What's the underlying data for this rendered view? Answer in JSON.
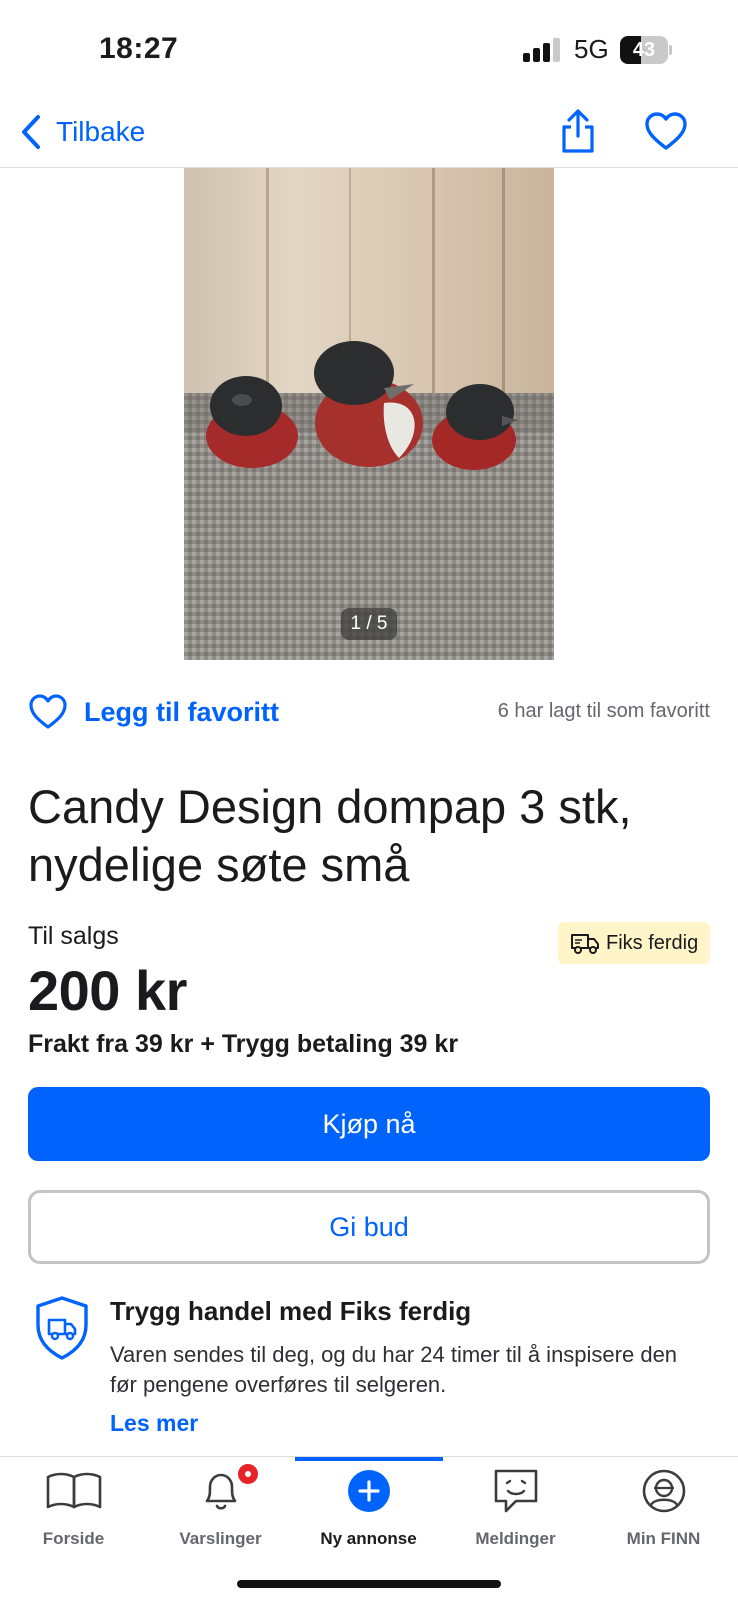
{
  "status_bar": {
    "time": "18:27",
    "network": "5G",
    "battery": "43",
    "battery_level": 0.43
  },
  "nav": {
    "back_label": "Tilbake"
  },
  "gallery": {
    "counter": "1 / 5"
  },
  "favorite": {
    "add_label": "Legg til favoritt",
    "count_text": "6 har lagt til som favoritt"
  },
  "listing": {
    "title": "Candy Design dompap 3 stk, nydelige søte små",
    "sale_label": "Til salgs",
    "badge_label": "Fiks ferdig",
    "price": "200 kr",
    "shipping": "Frakt fra 39 kr + Trygg betaling 39 kr"
  },
  "actions": {
    "buy_label": "Kjøp nå",
    "bid_label": "Gi bud"
  },
  "safe_trade": {
    "title": "Trygg handel med Fiks ferdig",
    "text": "Varen sendes til deg, og du har 24 timer til å inspisere den før pengene overføres til selgeren.",
    "link": "Les mer"
  },
  "tabs": [
    {
      "label": "Forside",
      "icon": "book-icon"
    },
    {
      "label": "Varslinger",
      "icon": "bell-icon"
    },
    {
      "label": "Ny annonse",
      "icon": "plus-circle-icon",
      "active": true
    },
    {
      "label": "Meldinger",
      "icon": "chat-icon"
    },
    {
      "label": "Min FINN",
      "icon": "profile-icon"
    }
  ],
  "colors": {
    "accent": "#0063fb",
    "badge_bg": "#fff5c8",
    "notification": "#e5242a"
  }
}
